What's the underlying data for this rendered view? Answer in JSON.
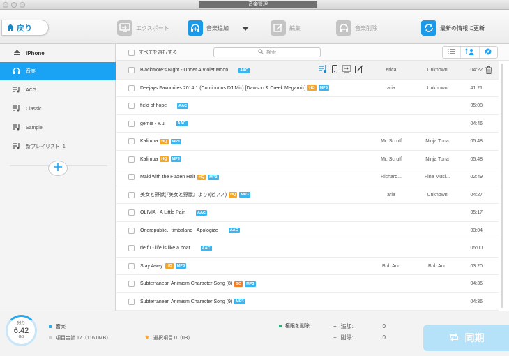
{
  "window": {
    "title": "音楽管理"
  },
  "toolbar": {
    "back_label": "戻り",
    "export_label": "エクスポート",
    "add_label": "音楽追加",
    "edit_label": "編集",
    "delete_label": "音楽削除",
    "refresh_label": "最新の情報に更新"
  },
  "sidebar": {
    "device": "iPhone",
    "items": [
      {
        "label": "音楽"
      },
      {
        "label": "ACG"
      },
      {
        "label": "Classic"
      },
      {
        "label": "Sample"
      },
      {
        "label": "新プレイリスト_1"
      }
    ]
  },
  "list": {
    "select_all_label": "すべてを選択する",
    "search_placeholder": "検索",
    "rows": [
      {
        "name": "Blackmore's Night - Under A Violet Moon",
        "badges": [
          "AAC"
        ],
        "artist": "erica",
        "album": "Unknown",
        "duration": "04:22"
      },
      {
        "name": "Deejays Favourites 2014.1 (Continuous DJ Mix) [Dawson & Creek Megamix]",
        "badges": [
          "HQ",
          "MP3"
        ],
        "artist": "aria",
        "album": "Unknown",
        "duration": "41:21"
      },
      {
        "name": "field of hope",
        "badges": [
          "AAC"
        ],
        "artist": "",
        "album": "",
        "duration": "05:08"
      },
      {
        "name": "gemie - x.u.",
        "badges": [
          "AAC"
        ],
        "artist": "",
        "album": "",
        "duration": "04:46"
      },
      {
        "name": "Kalimba",
        "badges": [
          "HQ",
          "MP3"
        ],
        "artist": "Mr. Scruff",
        "album": "Ninja Tuna",
        "duration": "05:48"
      },
      {
        "name": "Kalimba",
        "badges": [
          "HQ",
          "MP3"
        ],
        "artist": "Mr. Scruff",
        "album": "Ninja Tuna",
        "duration": "05:48"
      },
      {
        "name": "Maid with the Flaxen Hair",
        "badges": [
          "HQ",
          "MP3"
        ],
        "artist": "Richard...",
        "album": "Fine Musi...",
        "duration": "02:49"
      },
      {
        "name": "美女と野獣(『美女と野獣』より)(ピアノ)",
        "badges": [
          "HQ",
          "MP3"
        ],
        "artist": "aria",
        "album": "Unknown",
        "duration": "04:27"
      },
      {
        "name": "OLIVIA - A Little Pain",
        "badges": [
          "AAC"
        ],
        "artist": "",
        "album": "",
        "duration": "05:17"
      },
      {
        "name": "Onerepublic、timbaland - Apologize",
        "badges": [
          "AAC"
        ],
        "artist": "",
        "album": "",
        "duration": "03:04"
      },
      {
        "name": "rie fu - life is like a boat",
        "badges": [
          "AAC"
        ],
        "artist": "",
        "album": "",
        "duration": "05:00"
      },
      {
        "name": "Stay Away",
        "badges": [
          "HQ",
          "MP3"
        ],
        "artist": "Bob Acri",
        "album": "Bob Acri",
        "duration": "03:20"
      },
      {
        "name": "Subterranean Animism Character Song (8)",
        "badges": [
          "SQ",
          "MP3"
        ],
        "artist": "",
        "album": "",
        "duration": "04:36"
      },
      {
        "name": "Subterranean Animism Character Song (9)",
        "badges": [
          "MP3"
        ],
        "artist": "",
        "album": "",
        "duration": "04:36"
      }
    ]
  },
  "footer": {
    "remaining_label": "残り",
    "remaining_value": "6.42",
    "remaining_unit": "GB",
    "music_label": "音楽",
    "total_label": "項目合計 17（116.0MB）",
    "selected_label": "選択項目 0（0B）",
    "permission_label": "権限を削除",
    "add_label": "追加:",
    "add_value": "0",
    "del_label": "削除:",
    "del_value": "0",
    "sync_label": "同期"
  },
  "colors": {
    "accent": "#1aa3f5",
    "hq": "#f5a623",
    "sq": "#f57c23",
    "format": "#3bb5f0"
  }
}
